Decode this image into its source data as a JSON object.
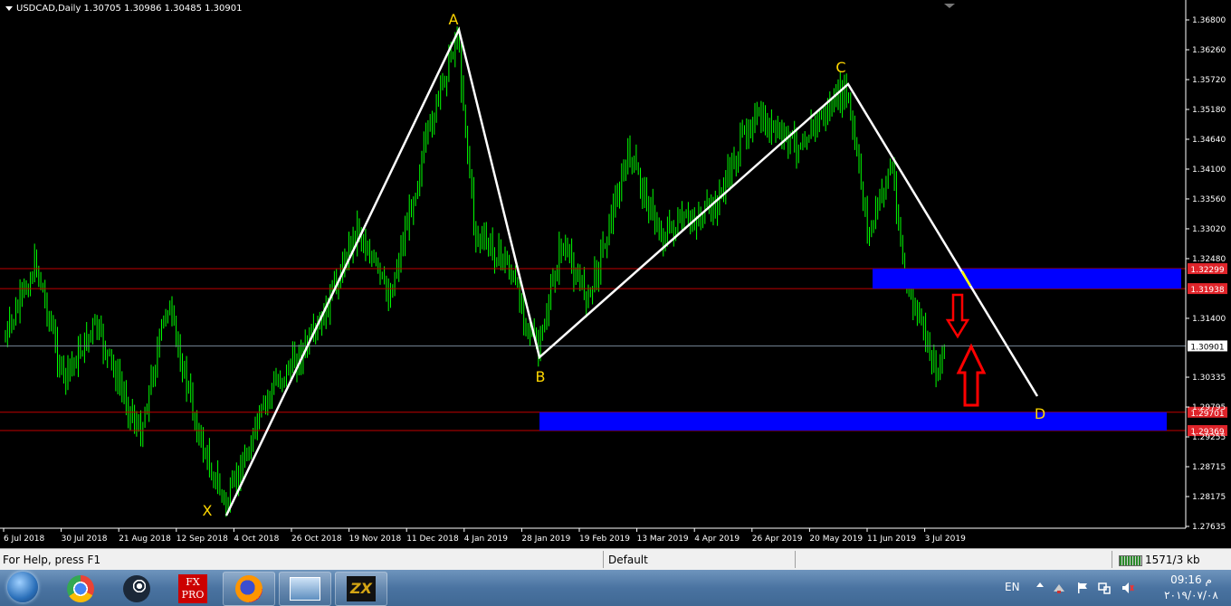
{
  "chart": {
    "header": "USDCAD,Daily  1.30705 1.30986 1.30485 1.30901",
    "price_ticks": [
      "1.36800",
      "1.36260",
      "1.35720",
      "1.35180",
      "1.34640",
      "1.34100",
      "1.33560",
      "1.33020",
      "1.32480",
      "1.31400",
      "1.30335",
      "1.29795",
      "1.29255",
      "1.28715",
      "1.28175",
      "1.27635"
    ],
    "price_tick_values": [
      1.368,
      1.3626,
      1.3572,
      1.3518,
      1.3464,
      1.341,
      1.3356,
      1.3302,
      1.3248,
      1.314,
      1.30335,
      1.29795,
      1.29255,
      1.28715,
      1.28175,
      1.27635
    ],
    "time_ticks": [
      "6 Jul 2018",
      "30 Jul 2018",
      "21 Aug 2018",
      "12 Sep 2018",
      "4 Oct 2018",
      "26 Oct 2018",
      "19 Nov 2018",
      "11 Dec 2018",
      "4 Jan 2019",
      "28 Jan 2019",
      "19 Feb 2019",
      "13 Mar 2019",
      "4 Apr 2019",
      "26 Apr 2019",
      "20 May 2019",
      "11 Jun 2019",
      "3 Jul 2019"
    ],
    "price_labels": [
      {
        "text": "1.32299",
        "value": 1.32299,
        "kind": "red"
      },
      {
        "text": "1.31938",
        "value": 1.31938,
        "kind": "red"
      },
      {
        "text": "1.30901",
        "value": 1.30901,
        "kind": "current"
      },
      {
        "text": "1.29701",
        "value": 1.29701,
        "kind": "red"
      },
      {
        "text": "1.29369",
        "value": 1.29369,
        "kind": "red"
      }
    ],
    "pattern_labels": [
      "X",
      "A",
      "B",
      "C",
      "D"
    ],
    "colors": {
      "candles": "#00ff00",
      "pattern": "#ffffff",
      "labels": "#ffd700",
      "zones": "#0000ff",
      "levels": "#c00000",
      "arrows": "#ff0000",
      "current": "#708090"
    }
  },
  "statusbar": {
    "help": "For Help, press F1",
    "profile": "Default",
    "traffic": "1571/3 kb"
  },
  "taskbar": {
    "lang": "EN",
    "time": "09:16 م",
    "date": "۲۰۱۹/۰۷/۰۸",
    "fxpro_line1": "FX",
    "fxpro_line2": "PRO",
    "apps": [
      "windows-start",
      "chrome",
      "steam",
      "fxpro",
      "firefox",
      "window",
      "zulutrade"
    ]
  }
}
